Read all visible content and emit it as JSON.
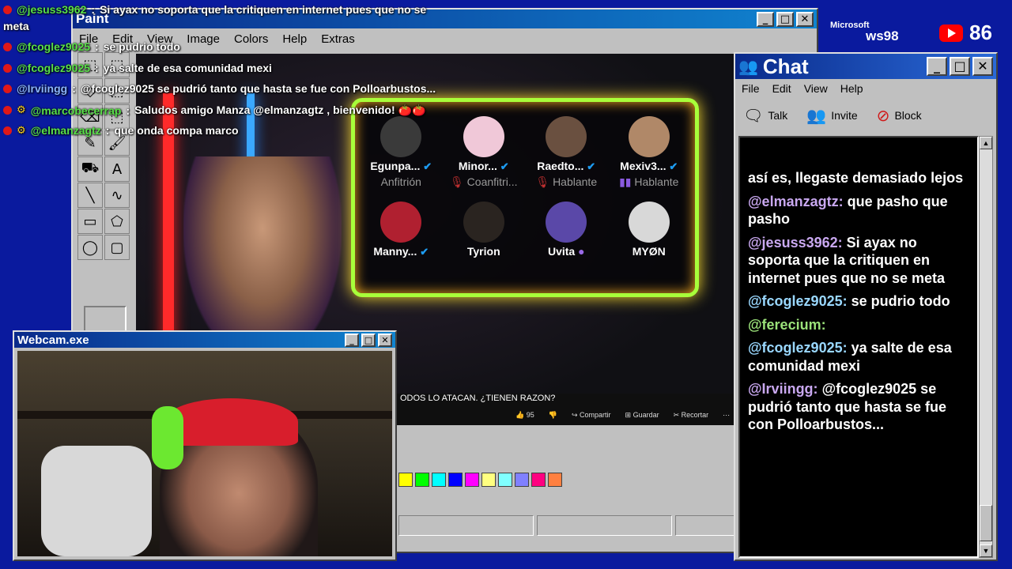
{
  "overlay_chat": [
    {
      "user": "@jesuss3962",
      "sep": " : ",
      "text": "Si ayax no soporta que la critiquen en internet pues que no se",
      "mod": false,
      "color": "green"
    },
    {
      "user": "",
      "sep": "",
      "text": "meta",
      "mod": false,
      "color": "green"
    },
    {
      "user": "@fcoglez9025",
      "sep": " : ",
      "text": "se pudrio todo",
      "mod": false,
      "color": "green"
    },
    {
      "user": "@fcoglez9025",
      "sep": " : ",
      "text": "ya salte de esa comunidad mexi",
      "mod": false,
      "color": "green"
    },
    {
      "user": "@Irviingg",
      "sep": " : ",
      "text": "@fcoglez9025 se pudrió tanto que hasta se fue con Polloarbustos...",
      "mod": false,
      "color": "blue"
    },
    {
      "user": "@marcobecerrap",
      "sep": " : ",
      "text": "Saludos amigo Manza @elmanzagtz , bienvenido! 🍅🍅",
      "mod": true,
      "color": "green"
    },
    {
      "user": "@elmanzagtz",
      "sep": " : ",
      "text": "que onda compa marco",
      "mod": true,
      "color": "green"
    }
  ],
  "paint": {
    "title": "Paint",
    "menu": [
      "File",
      "Edit",
      "View",
      "Image",
      "Colors",
      "Help",
      "Extras"
    ],
    "tools": [
      "⬚",
      "⬚",
      "◇",
      "⬚",
      "⌫",
      "⬚",
      "✎",
      "🖌",
      "⛟",
      "A",
      "╲",
      "∿",
      "▭",
      "⬠",
      "◯",
      "▢"
    ],
    "palette": [
      "#ffff00",
      "#00ff00",
      "#00ffff",
      "#0000ff",
      "#ff00ff",
      "#ffff80",
      "#80ffff",
      "#8080ff",
      "#ff0080",
      "#ff8040"
    ]
  },
  "spaces": {
    "speakers": [
      {
        "name": "Egunpa...",
        "role": "Anfitrión",
        "verified": true
      },
      {
        "name": "Minor...",
        "role": "Coanfitri...",
        "verified": true
      },
      {
        "name": "Raedto...",
        "role": "Hablante",
        "verified": true
      },
      {
        "name": "Mexiv3...",
        "role": "Hablante",
        "verified": true
      },
      {
        "name": "Manny...",
        "role": "",
        "verified": true
      },
      {
        "name": "Tyrion",
        "role": "",
        "verified": false
      },
      {
        "name": "Uvita",
        "role": "",
        "verified": false
      },
      {
        "name": "MYØN",
        "role": "",
        "verified": false
      }
    ]
  },
  "youtube": {
    "title": "ODOS LO ATACAN. ¿TIENEN RAZON?",
    "likes": "95",
    "share": "Compartir",
    "save": "Guardar",
    "clip": "Recortar"
  },
  "desktop": {
    "ms_label": "Microsoft",
    "os_label": "ws98",
    "viewer_count": "86"
  },
  "chat_window": {
    "title": "Chat",
    "menu": [
      "File",
      "Edit",
      "View",
      "Help"
    ],
    "toolbar": [
      {
        "label": "Talk",
        "icon": "talk-icon",
        "glyph": "🗨"
      },
      {
        "label": "Invite",
        "icon": "invite-icon",
        "glyph": "👥"
      },
      {
        "label": "Block",
        "icon": "block-icon",
        "glyph": "⊘"
      }
    ],
    "messages": [
      {
        "user": "",
        "text": "así es, llegaste demasiado lejos",
        "color": "purple"
      },
      {
        "user": "@elmanzagtz:",
        "text": "que pasho que pasho",
        "color": "purple"
      },
      {
        "user": "@jesuss3962:",
        "text": "Si ayax no soporta que la critiquen en internet pues que no se meta",
        "color": "purple"
      },
      {
        "user": "@fcoglez9025:",
        "text": "se pudrio todo",
        "color": "blue"
      },
      {
        "user": "@ferecium:",
        "text": "",
        "color": "green"
      },
      {
        "user": "@fcoglez9025:",
        "text": "ya salte de esa comunidad mexi",
        "color": "blue"
      },
      {
        "user": "@Irviingg:",
        "text": "@fcoglez9025 se pudrió tanto que hasta se fue con Polloarbustos...",
        "color": "purple"
      }
    ]
  },
  "webcam": {
    "title": "Webcam.exe"
  },
  "colors": {
    "desktop": "#0a1a9e",
    "titlebar": "#0a2a8a",
    "neon": "#a8ff3a"
  }
}
